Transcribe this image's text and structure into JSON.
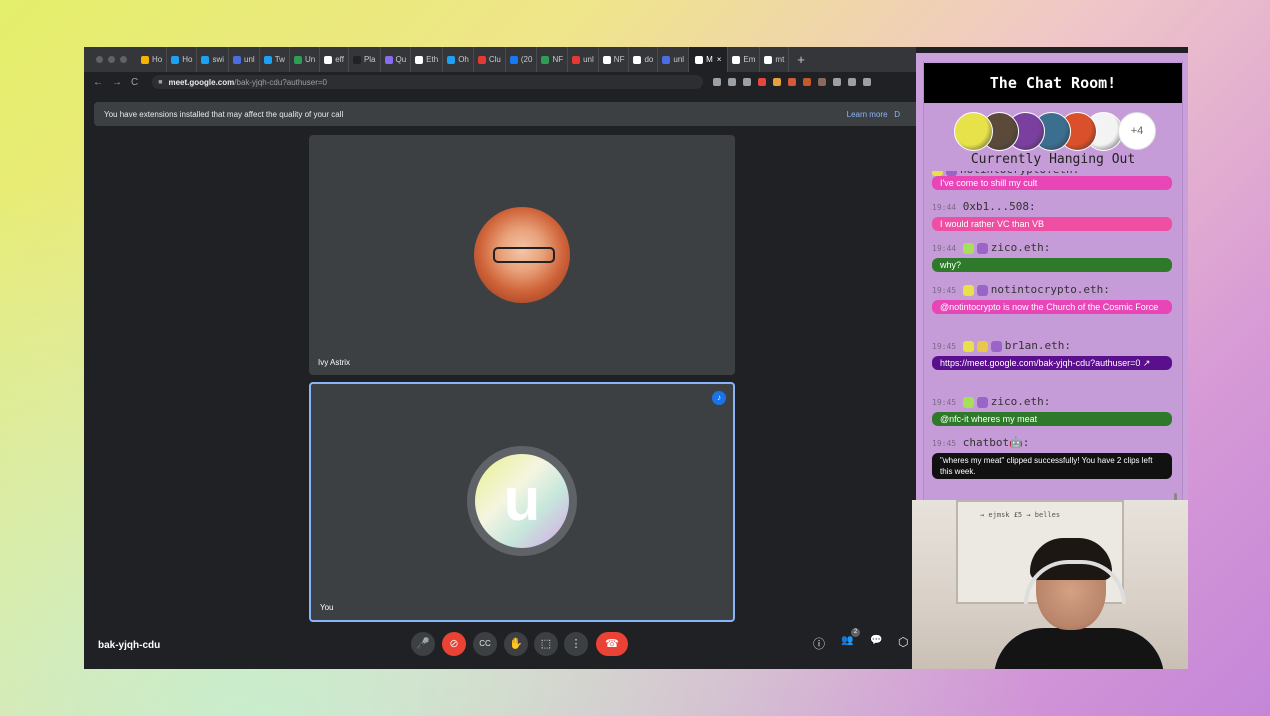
{
  "browser": {
    "tabs": [
      {
        "label": "Ho",
        "color": "#f5b400"
      },
      {
        "label": "Ho",
        "color": "#1da1f2"
      },
      {
        "label": "swi",
        "color": "#1da1f2"
      },
      {
        "label": "unl",
        "color": "#4a6ee0"
      },
      {
        "label": "Tw",
        "color": "#1da1f2"
      },
      {
        "label": "Un",
        "color": "#2e9e55"
      },
      {
        "label": "eff",
        "color": "#ffffff"
      },
      {
        "label": "Pla",
        "color": "#222222"
      },
      {
        "label": "Qu",
        "color": "#8a6cf0"
      },
      {
        "label": "Eth",
        "color": "#ffffff"
      },
      {
        "label": "Oh",
        "color": "#1da1f2"
      },
      {
        "label": "Clu",
        "color": "#e53935"
      },
      {
        "label": "(20",
        "color": "#1877f2"
      },
      {
        "label": "NF",
        "color": "#2e9e55"
      },
      {
        "label": "unl",
        "color": "#e53935"
      },
      {
        "label": "NF",
        "color": "#ffffff"
      },
      {
        "label": "do",
        "color": "#ffffff"
      },
      {
        "label": "unl",
        "color": "#4a6ee0"
      }
    ],
    "active_tab_label": "M",
    "active_tab_close": "×",
    "tabs_after": [
      {
        "label": "Em",
        "color": "#ffffff"
      },
      {
        "label": "mt",
        "color": "#ffffff"
      }
    ],
    "new_tab": "+",
    "url_host": "meet.google.com",
    "url_path": "/bak-yjqh-cdu?authuser=0",
    "nav": {
      "back": "←",
      "forward": "→",
      "reload": "C",
      "lock": "■"
    }
  },
  "notice": {
    "message": "You have extensions installed that may affect the quality of your call",
    "learn_more": "Learn more",
    "dismiss": "D"
  },
  "meeting": {
    "code": "bak-yjqh-cdu",
    "participants": [
      {
        "name": "Ivy Astrix"
      },
      {
        "name": "You",
        "initial": "u"
      }
    ],
    "people_count": "2",
    "controls": {
      "mic": "🎤",
      "camera_off": "⊘",
      "captions": "CC",
      "raise_hand": "✋",
      "present": "⬚",
      "more": "⋮",
      "end_call": "☎"
    },
    "right_icons": {
      "info": "ⓘ",
      "people": "👥",
      "chat": "💬",
      "activities": "⬡"
    },
    "speaker_icon": "♪"
  },
  "chat": {
    "title": "The Chat Room!",
    "extra_count": "+4",
    "hanging_out": "Currently Hanging Out",
    "avatar_colors": [
      "#e8e24a",
      "#5b4a3a",
      "#7b3fa0",
      "#3b6e8f",
      "#d9502a",
      "#f3f3f3"
    ],
    "messages": [
      {
        "time": "",
        "user": "notintocrypto.eth:",
        "text": "I've come to shill my cult",
        "style": "pink",
        "tags": [
          "#e8e24a",
          "#9a64c8"
        ]
      },
      {
        "time": "19:44",
        "user": "0xb1...508:",
        "text": "I would rather VC than VB",
        "style": "hotpink",
        "tags": []
      },
      {
        "time": "19:44",
        "user": "zico.eth:",
        "text": "why?",
        "style": "green",
        "tags": [
          "#a6e05a",
          "#9a64c8"
        ]
      },
      {
        "time": "19:45",
        "user": "notintocrypto.eth:",
        "text": "@notintocrypto is now the Church of the Cosmic Force",
        "style": "pink",
        "tags": [
          "#e8e24a",
          "#9a64c8"
        ]
      },
      {
        "time": "19:45",
        "user": "br1an.eth:",
        "text": "https://meet.google.com/bak-yjqh-cdu?authuser=0 ↗",
        "style": "purple",
        "tags": [
          "#e8e24a",
          "#e8c84a",
          "#9a64c8"
        ]
      },
      {
        "time": "19:45",
        "user": "zico.eth:",
        "text": "@nfc-it wheres my meat",
        "style": "green",
        "tags": [
          "#a6e05a",
          "#9a64c8"
        ]
      },
      {
        "time": "19:45",
        "user": "chatbot🤖:",
        "text": "\"wheres my meat\" clipped successfully! You have 2 clips left this week.",
        "style": "black",
        "tags": []
      }
    ]
  },
  "webcam": {
    "whiteboard_text": "→ ejmsk £5 → belles"
  }
}
